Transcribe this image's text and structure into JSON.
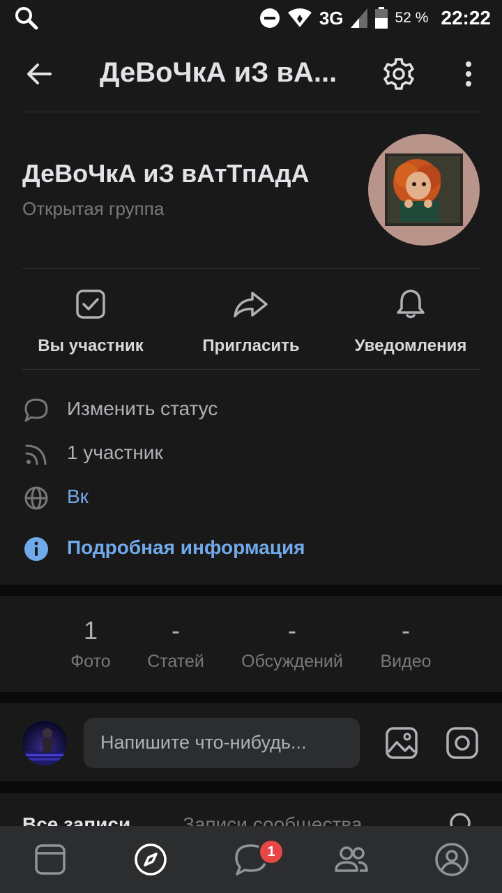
{
  "status_bar": {
    "network": "3G",
    "battery": "52 %",
    "time": "22:22"
  },
  "header": {
    "title": "ДеВоЧкА иЗ вА..."
  },
  "group": {
    "name": "ДеВоЧкА иЗ вАтТпАдА",
    "type": "Открытая группа"
  },
  "actions": [
    {
      "label": "Вы участник",
      "icon": "checkbox-icon"
    },
    {
      "label": "Пригласить",
      "icon": "share-arrow-icon"
    },
    {
      "label": "Уведомления",
      "icon": "bell-icon"
    }
  ],
  "info": {
    "status": "Изменить статус",
    "members": "1 участник",
    "website": "Вк",
    "details": "Подробная информация"
  },
  "counters": [
    {
      "value": "1",
      "label": "Фото"
    },
    {
      "value": "-",
      "label": "Статей"
    },
    {
      "value": "-",
      "label": "Обсуждений"
    },
    {
      "value": "-",
      "label": "Видео"
    }
  ],
  "composer": {
    "placeholder": "Напишите что-нибудь..."
  },
  "wall_tabs": {
    "all": "Все записи",
    "community": "Записи сообщества"
  },
  "bottom_nav": {
    "messages_badge": "1"
  },
  "colors": {
    "background": "#19191a",
    "page": "#0a0a0a",
    "link": "#71aaeb",
    "badge": "#e64646",
    "nav": "#2c2d2e"
  }
}
